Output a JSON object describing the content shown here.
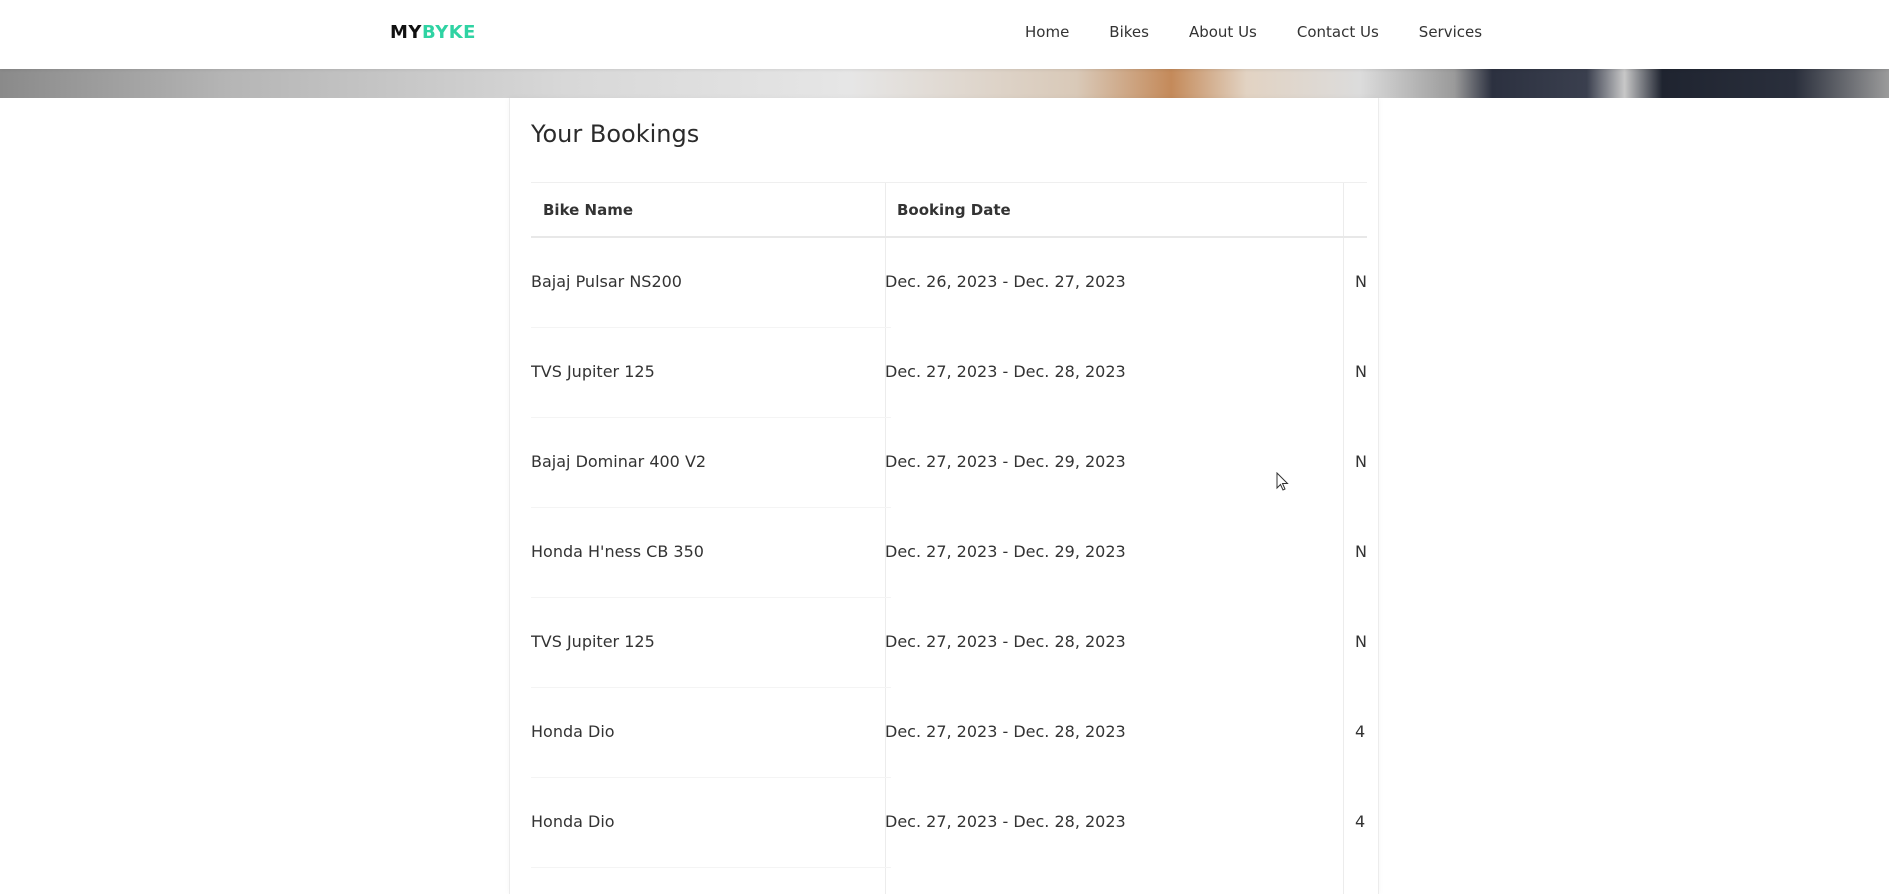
{
  "brand": {
    "part1": "MY",
    "part2": "BYKE"
  },
  "nav": {
    "items": [
      "Home",
      "Bikes",
      "About Us",
      "Contact Us",
      "Services"
    ]
  },
  "bookings": {
    "title": "Your Bookings",
    "columns": [
      "Bike Name",
      "Booking Date"
    ],
    "rows": [
      {
        "bike": "Bajaj Pulsar NS200",
        "date": "Dec. 26, 2023 - Dec. 27, 2023",
        "extra": "N"
      },
      {
        "bike": "TVS Jupiter 125",
        "date": "Dec. 27, 2023 - Dec. 28, 2023",
        "extra": "N"
      },
      {
        "bike": "Bajaj Dominar 400 V2",
        "date": "Dec. 27, 2023 - Dec. 29, 2023",
        "extra": "N"
      },
      {
        "bike": "Honda H'ness CB 350",
        "date": "Dec. 27, 2023 - Dec. 29, 2023",
        "extra": "N"
      },
      {
        "bike": "TVS Jupiter 125",
        "date": "Dec. 27, 2023 - Dec. 28, 2023",
        "extra": "N"
      },
      {
        "bike": "Honda Dio",
        "date": "Dec. 27, 2023 - Dec. 28, 2023",
        "extra": "4:"
      },
      {
        "bike": "Honda Dio",
        "date": "Dec. 27, 2023 - Dec. 28, 2023",
        "extra": "4:"
      }
    ]
  },
  "colors": {
    "brand_accent": "#2fd3a3",
    "text": "#333333"
  }
}
